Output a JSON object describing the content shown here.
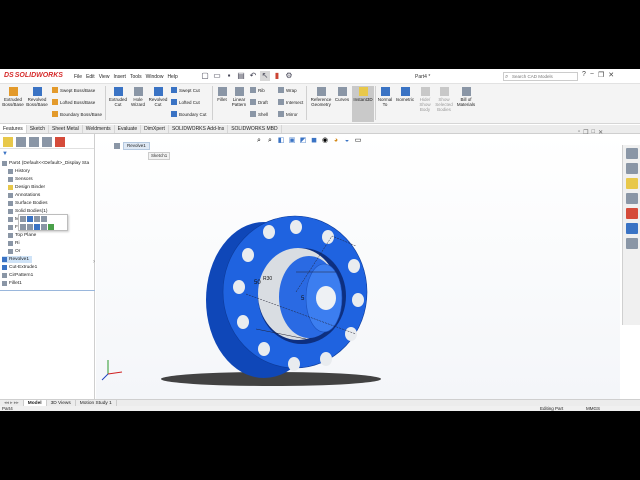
{
  "app": {
    "brand": "SOLIDWORKS",
    "brand_mark": "DS",
    "document_title": "Part4 *",
    "search_placeholder": "Search CAD Models",
    "window_controls": [
      "?",
      "−",
      "❐",
      "✕"
    ]
  },
  "menu": [
    "File",
    "Edit",
    "View",
    "Insert",
    "Tools",
    "Window",
    "Help"
  ],
  "quick_access": [
    "new-icon",
    "open-icon",
    "save-icon",
    "print-icon",
    "undo-icon",
    "select-icon",
    "rebuild-icon",
    "options-icon"
  ],
  "ribbon": {
    "extruded_boss": "Extruded\nBoss/Base",
    "revolved_boss": "Revolved\nBoss/Base",
    "swept_boss": "Swept Boss/Base",
    "lofted_boss": "Lofted Boss/Base",
    "boundary_boss": "Boundary Boss/Base",
    "extruded_cut": "Extruded\nCut",
    "hole_wizard": "Hole\nWizard",
    "revolved_cut": "Revolved\nCut",
    "swept_cut": "Swept Cut",
    "lofted_cut": "Lofted Cut",
    "boundary_cut": "Boundary Cut",
    "fillet": "Fillet",
    "linear_pattern": "Linear\nPattern",
    "rib": "Rib",
    "draft": "Draft",
    "shell": "Shell",
    "wrap": "Wrap",
    "intersect": "Intersect",
    "mirror": "Mirror",
    "reference_geometry": "Reference\nGeometry",
    "curves": "Curves",
    "instant3d": "Instant3D",
    "normal_to": "Normal\nTo",
    "isometric": "Isometric",
    "hide_show_body": "Hide/\nShow\nBody",
    "show_selected": "Show\nSelected\nBodies",
    "bill_of_materials": "Bill of\nMaterials"
  },
  "command_tabs": [
    "Features",
    "Sketch",
    "Sheet Metal",
    "Weldments",
    "Evaluate",
    "DimXpert",
    "SOLIDWORKS Add-Ins",
    "SOLIDWORKS MBD"
  ],
  "tree": {
    "root": "Part4  (Default<<Default>_Display Sta",
    "items": [
      {
        "label": "History",
        "icon": "history-icon"
      },
      {
        "label": "Sensors",
        "icon": "sensors-icon"
      },
      {
        "label": "Design Binder",
        "icon": "binder-icon"
      },
      {
        "label": "Annotations",
        "icon": "annotations-icon"
      },
      {
        "label": "Surface Bodies",
        "icon": "surface-bodies-icon"
      },
      {
        "label": "Solid Bodies(1)",
        "icon": "solid-bodies-icon"
      },
      {
        "label": "Material <not specified>",
        "icon": "material-icon"
      },
      {
        "label": "Front Plane",
        "icon": "plane-icon"
      },
      {
        "label": "Top Plane",
        "icon": "plane-icon"
      },
      {
        "label": "Ri",
        "icon": "plane-icon"
      },
      {
        "label": "Or",
        "icon": "origin-icon"
      },
      {
        "label": "Revolve1",
        "icon": "revolve-icon"
      },
      {
        "label": "Cut-Extrude1",
        "icon": "cut-extrude-icon"
      },
      {
        "label": "CirPattern1",
        "icon": "circular-pattern-icon"
      },
      {
        "label": "Fillet1",
        "icon": "fillet-icon"
      }
    ]
  },
  "viewport": {
    "breadcrumb": "Revolve1",
    "sketch_tag": "Sketch1",
    "dim_50": "50",
    "dim_r": "R30",
    "dim_5": "5",
    "part_color": "#1f63e0"
  },
  "bottom_tabs": [
    "",
    "Model",
    "3D Views",
    "Motion Study 1"
  ],
  "status": {
    "left": "Part4",
    "middle": "Editing Part",
    "right": "MMGS"
  }
}
